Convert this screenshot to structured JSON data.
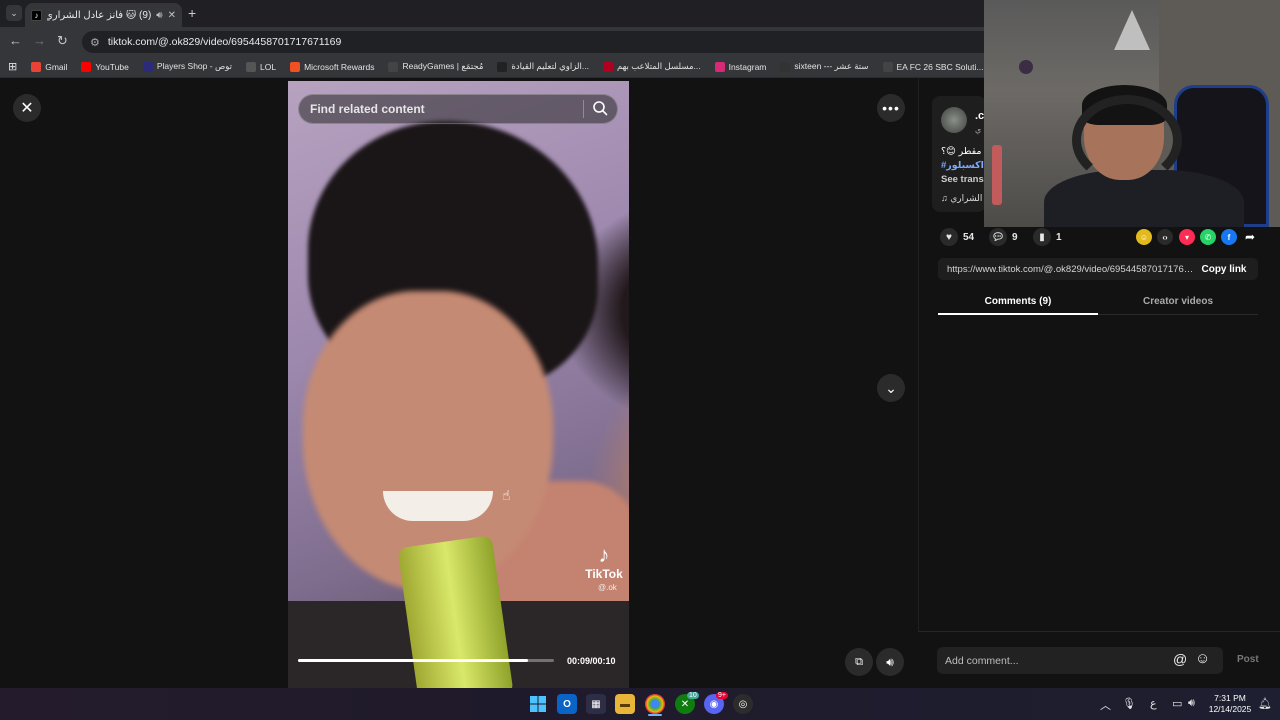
{
  "browser": {
    "tab_title": "(9) 🐱 فانز عادل الشراري 🐱",
    "url": "tiktok.com/@.ok829/video/6954458701717671169",
    "bookmarks": [
      {
        "label": "Gmail",
        "icon": "gmail-icon",
        "color": "#ea4335"
      },
      {
        "label": "YouTube",
        "icon": "youtube-icon",
        "color": "#ff0000"
      },
      {
        "label": "Players Shop - توص",
        "icon": "players-shop-icon",
        "color": "#2b2b7a"
      },
      {
        "label": "LOL",
        "icon": "globe-icon",
        "color": "#555555"
      },
      {
        "label": "Microsoft Rewards",
        "icon": "microsoft-icon",
        "color": "#f25022"
      },
      {
        "label": "ReadyGames | مُجتمَع",
        "icon": "readygames-icon",
        "color": "#444444"
      },
      {
        "label": "الزاوي لتعليم القيادة...",
        "icon": "zawi-icon",
        "color": "#222222"
      },
      {
        "label": "مسلسل المتلاعب بهم...",
        "icon": "series-icon",
        "color": "#b00020"
      },
      {
        "label": "Instagram",
        "icon": "instagram-icon",
        "color": "#d62976"
      },
      {
        "label": "sixteen --- ستة عشر",
        "icon": "sixteen-icon",
        "color": "#333333"
      },
      {
        "label": "EA FC 26 SBC Soluti...",
        "icon": "ea-icon",
        "color": "#444444"
      }
    ]
  },
  "video": {
    "search_placeholder": "Find related content",
    "time": "00:09/00:10",
    "progress": 0.9,
    "watermark": "TikTok",
    "watermark_handle": "@.ok"
  },
  "author": {
    "name": ".c",
    "sub": "ي"
  },
  "description": {
    "text": "ن مقطر 😊؟",
    "hashtag": "#اكسبلور",
    "see_translation": "See trans",
    "music": "الشراري"
  },
  "actions": {
    "likes": "54",
    "comments": "9",
    "saves": "1"
  },
  "share": {
    "link": "https://www.tiktok.com/@.ok829/video/6954458701717671...",
    "copy_label": "Copy link"
  },
  "tabs": {
    "comments": "Comments (9)",
    "creator": "Creator videos"
  },
  "comment_box": {
    "placeholder": "Add comment...",
    "post_label": "Post"
  },
  "taskbar": {
    "time": "7:31 PM",
    "date": "12/14/2025",
    "lang": "ع",
    "badge_discord": "9+",
    "badge_xbox": "10"
  },
  "colors": {
    "accent_blue": "#7da9ff",
    "progress_white": "#ffffff"
  }
}
